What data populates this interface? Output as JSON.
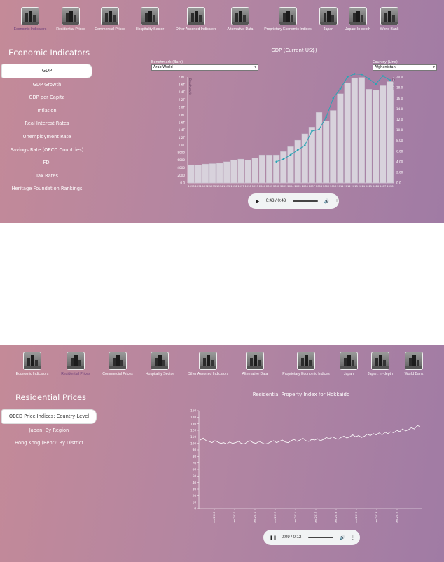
{
  "top": {
    "nav": [
      {
        "label": "Economic Indicators",
        "active": true
      },
      {
        "label": "Residential Prices",
        "active": false
      },
      {
        "label": "Commercial Prices",
        "active": false
      },
      {
        "label": "Hospitality Sector",
        "active": false
      },
      {
        "label": "Other Assorted Indicators",
        "active": false
      },
      {
        "label": "Alternative Data",
        "active": false
      },
      {
        "label": "Proprietary Economic Indices",
        "active": false
      },
      {
        "label": "Japan",
        "active": false
      },
      {
        "label": "Japan: In-depth",
        "active": false
      },
      {
        "label": "World Bank",
        "active": false
      }
    ],
    "section_title": "Economic Indicators",
    "side_items": [
      "GDP",
      "GDP Growth",
      "GDP per Capita",
      "Inflation",
      "Real Interest Rates",
      "Unemployment Rate",
      "Savings Rate (OECD Countries)",
      "FDI",
      "Tax Rates",
      "Heritage Foundation Rankings"
    ],
    "chart_title": "GDP (Current US$)",
    "benchmark_label": "Benchmark (Bars)",
    "benchmark_value": "Arab World",
    "country_label": "Country (Line)",
    "country_value": "Afghanistan",
    "audio_time": "0:43 / 0:43"
  },
  "bottom": {
    "nav": [
      {
        "label": "Economic Indicators",
        "active": false
      },
      {
        "label": "Residential Prices",
        "active": true
      },
      {
        "label": "Commercial Prices",
        "active": false
      },
      {
        "label": "Hospitality Sector",
        "active": false
      },
      {
        "label": "Other Assorted Indicators",
        "active": false
      },
      {
        "label": "Alternative Data",
        "active": false
      },
      {
        "label": "Proprietary Economic Indices",
        "active": false
      },
      {
        "label": "Japan",
        "active": false
      },
      {
        "label": "Japan: In-depth",
        "active": false
      },
      {
        "label": "World Bank",
        "active": false
      }
    ],
    "section_title": "Residential Prices",
    "side_items": [
      "OECD Price Indices: Country-Level",
      "Japan: By Region",
      "Hong Kong (Rent): By District"
    ],
    "chart_title": "Residential Property Index for Hokkaido",
    "audio_time": "0:09 / 0:12"
  },
  "colors": {
    "bar": "#d8d2dc",
    "line": "#2aa5b5",
    "axis": "#ffffff",
    "active_nav": "#6c3e7a"
  },
  "icons": {
    "nav": "city-building-icon",
    "play": "play-icon",
    "pause": "pause-icon",
    "volume": "volume-icon",
    "more": "more-vertical-icon"
  },
  "chart_data": [
    {
      "type": "bar",
      "title": "GDP (Current US$)",
      "x": [
        "1990",
        "1991",
        "1992",
        "1993",
        "1994",
        "1995",
        "1996",
        "1997",
        "1998",
        "1999",
        "2000",
        "2001",
        "2002",
        "2003",
        "2004",
        "2005",
        "2006",
        "2007",
        "2008",
        "2009",
        "2010",
        "2011",
        "2012",
        "2013",
        "2014",
        "2015",
        "2016",
        "2017",
        "2018"
      ],
      "series": [
        {
          "name": "Arab World",
          "type": "bar",
          "axis": "left",
          "values": [
            480,
            470,
            500,
            510,
            520,
            560,
            610,
            630,
            610,
            660,
            740,
            740,
            740,
            830,
            960,
            1130,
            1300,
            1480,
            1870,
            1640,
            1920,
            2360,
            2650,
            2780,
            2790,
            2480,
            2450,
            2570,
            2680
          ]
        },
        {
          "name": "Afghanistan",
          "type": "line",
          "axis": "right",
          "values": [
            null,
            null,
            null,
            null,
            null,
            null,
            null,
            null,
            null,
            null,
            null,
            null,
            4.0,
            4.5,
            5.3,
            6.2,
            7.1,
            9.8,
            10.1,
            12.4,
            16.0,
            17.8,
            20.0,
            20.6,
            20.5,
            19.7,
            18.7,
            20.2,
            19.4
          ]
        }
      ],
      "y_left_ticks": [
        "0.0",
        "2000",
        "4000",
        "6000",
        "8000",
        "1.0T",
        "1.2T",
        "1.4T",
        "1.6T",
        "1.8T",
        "2.0T",
        "2.2T",
        "2.4T",
        "2.6T",
        "2.8T"
      ],
      "y_right_ticks": [
        "0.0",
        "2.00",
        "4.00",
        "6.00",
        "8.00",
        "10.0",
        "12.0",
        "14.0",
        "16.0",
        "18.0",
        "20.0"
      ],
      "ylabel_left": "Benchmark",
      "ylabel_right": "Country",
      "ylim_left": [
        0,
        2800
      ],
      "ylim_right": [
        0,
        20
      ]
    },
    {
      "type": "line",
      "title": "Residential Property Index for Hokkaido",
      "x_ticks": [
        "Jan 2008",
        "Jan 2010",
        "Jan 2011",
        "Jan 2013",
        "Jan 2014",
        "Jan 2015",
        "Jan 2016",
        "Jan 2017",
        "Jan 2018",
        "Jan 2019"
      ],
      "series": [
        {
          "values": [
            105,
            108,
            104,
            103,
            101,
            104,
            102,
            100,
            101,
            99,
            102,
            100,
            101,
            103,
            100,
            99,
            102,
            104,
            101,
            100,
            103,
            101,
            99,
            100,
            102,
            104,
            101,
            103,
            105,
            102,
            101,
            104,
            106,
            103,
            105,
            108,
            104,
            103,
            106,
            105,
            107,
            104,
            106,
            109,
            107,
            110,
            108,
            106,
            109,
            111,
            108,
            110,
            113,
            110,
            112,
            109,
            111,
            114,
            112,
            115,
            113,
            116,
            113,
            117,
            115,
            118,
            116,
            120,
            118,
            122,
            119,
            121,
            124,
            122,
            127,
            126
          ]
        }
      ],
      "y_ticks": [
        "0",
        "10",
        "20",
        "30",
        "40",
        "50",
        "60",
        "70",
        "80",
        "90",
        "100",
        "110",
        "120",
        "130",
        "140",
        "150"
      ],
      "ylim": [
        0,
        150
      ]
    }
  ]
}
